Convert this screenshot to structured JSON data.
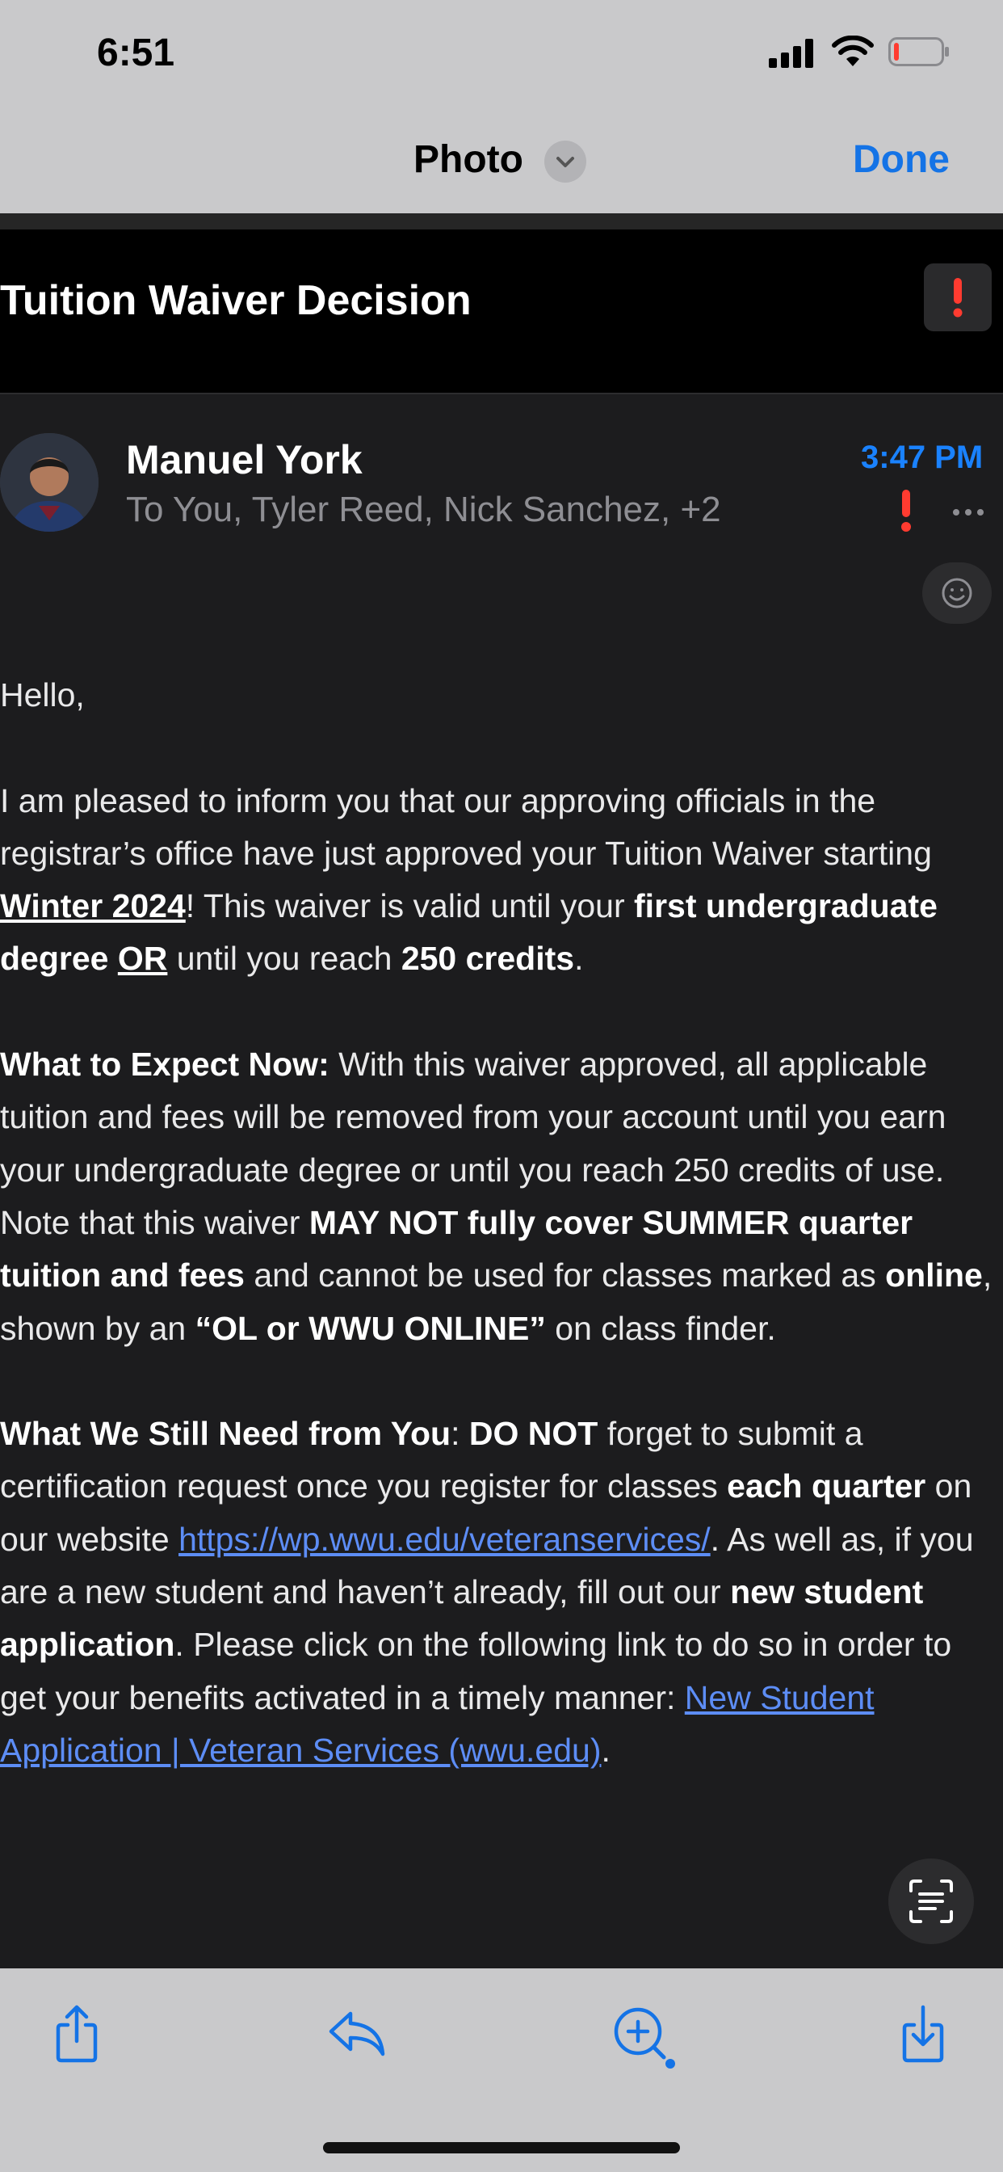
{
  "status_bar": {
    "time": "6:51",
    "icons": [
      "cellular-signal-icon",
      "wifi-icon",
      "battery-low-icon"
    ]
  },
  "nav": {
    "title": "Photo",
    "title_menu_icon": "chevron-down-icon",
    "done_label": "Done",
    "accent_color": "#1473e6"
  },
  "email": {
    "subject": "Tuition Waiver Decision",
    "sender": "Manuel York",
    "recipients": "To You, Tyler Reed, Nick Sanchez, +2",
    "time": "3:47 PM",
    "flag_color": "#ff3b30",
    "body": {
      "greeting": "Hello,",
      "p1": {
        "t1": "I am pleased to inform you that our approving officials in the registrar’s office have just approved your Tuition Waiver starting ",
        "winter": "Winter 2024",
        "t2": "! This waiver is valid until your ",
        "degree": "first undergraduate degree",
        "sp": " ",
        "or": "OR",
        "t3": " until you reach ",
        "credits": "250 credits",
        "t4": "."
      },
      "p2": {
        "heading": "What to Expect Now:",
        "t1": " With this waiver approved, all applicable tuition and fees will be removed from your account until you earn your undergraduate degree or until you reach 250 credits of use. Note that this waiver ",
        "b1": "MAY NOT fully cover SUMMER quarter tuition and fees",
        "t2": " and cannot be used for classes marked as ",
        "b2": "online",
        "t3": ", shown by an ",
        "b3": "“OL or WWU ONLINE”",
        "t4": " on class finder."
      },
      "p3": {
        "heading": "What We Still Need from You",
        "t1": ": ",
        "b1": "DO NOT",
        "t2": " forget to submit a certification request once you register for classes ",
        "b2": "each quarter",
        "t3": " on our website ",
        "link1": "https://wp.wwu.edu/veteranservices/",
        "t4": ". As well as, if you are a new student and haven’t already, fill out our ",
        "b3": "new student application",
        "t5": ". Please click on the following link to do so in order to get your benefits activated in a timely manner:  ",
        "link2": "New Student Application | Veteran Services (wwu.edu)",
        "t6": "."
      }
    }
  },
  "toolbar": {
    "items": [
      "share-icon",
      "reply-icon",
      "zoom-in-icon",
      "download-icon"
    ]
  }
}
